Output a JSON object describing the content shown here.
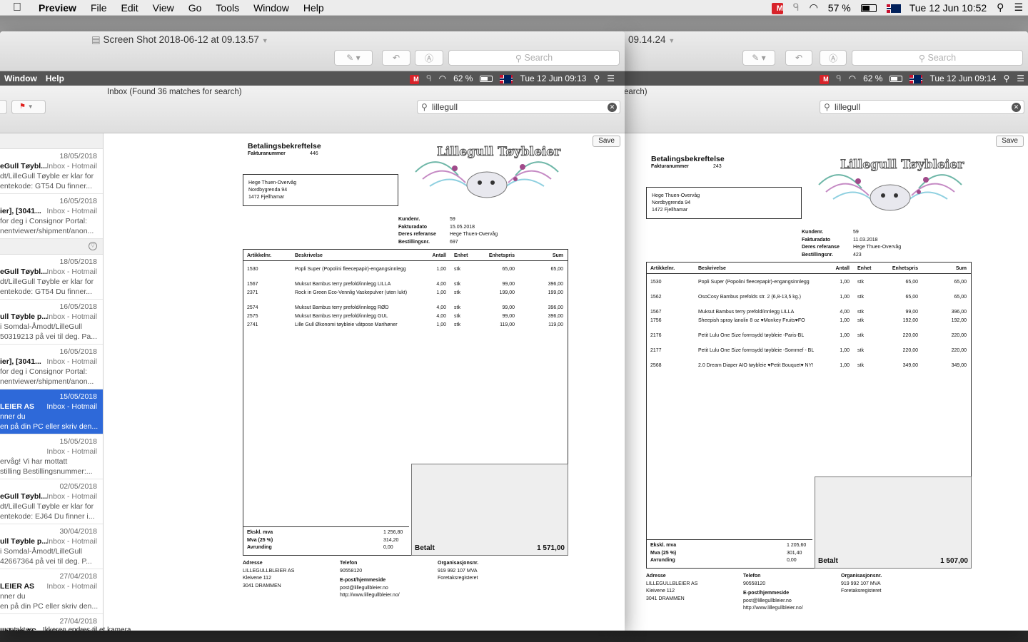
{
  "menubar": {
    "app": "Preview",
    "items": [
      "File",
      "Edit",
      "View",
      "Go",
      "Tools",
      "Window",
      "Help"
    ],
    "battery": "57 %",
    "datetime": "Tue 12 Jun  10:52"
  },
  "left_window": {
    "title": "Screen Shot 2018-06-12 at 09.13.57",
    "search_placeholder": "Search",
    "inner": {
      "menu": [
        "Window",
        "Help"
      ],
      "battery": "62 %",
      "datetime": "Tue 12 Jun  09:13",
      "mail_title": "Inbox (Found 36 matches for search)",
      "search_value": "lillegull",
      "save": "Save",
      "messages": [
        {
          "date": "18/05/2018",
          "from": "eGull Tøybl...",
          "box": "Inbox - Hotmail",
          "p1": "dt/LilleGull Tøyble er klar for",
          "p2": "entekode: GT54 Du finner..."
        },
        {
          "date": "16/05/2018",
          "from": "ier], [3041...",
          "box": "Inbox - Hotmail",
          "p1": "for deg i Consignor Portal:",
          "p2": "nentviewer/shipment/anon..."
        },
        {
          "date": "18/05/2018",
          "from": "eGull Tøybl...",
          "box": "Inbox - Hotmail",
          "p1": "dt/LilleGull Tøyble er klar for",
          "p2": "entekode: GT54 Du finner..."
        },
        {
          "date": "16/05/2018",
          "from": "ull Tøyble p...",
          "box": "Inbox - Hotmail",
          "p1": "i Somdal-Åmodt/LilleGull",
          "p2": "50319213 på vei til deg. Pa..."
        },
        {
          "date": "16/05/2018",
          "from": "ier], [3041...",
          "box": "Inbox - Hotmail",
          "p1": "for deg i Consignor Portal:",
          "p2": "nentviewer/shipment/anon..."
        },
        {
          "date": "15/05/2018",
          "from": "LEIER AS",
          "box": "Inbox - Hotmail",
          "p1": "nner du",
          "p2": "en på din PC eller skriv den...",
          "selected": true
        },
        {
          "date": "15/05/2018",
          "from": "",
          "box": "Inbox - Hotmail",
          "p1": "ervåg! Vi har mottatt",
          "p2": "stilling Bestillingsnummer:..."
        },
        {
          "date": "02/05/2018",
          "from": "eGull Tøybl...",
          "box": "Inbox - Hotmail",
          "p1": "dt/LilleGull Tøyble er klar for",
          "p2": "entekode: EJ64 Du finner i..."
        },
        {
          "date": "30/04/2018",
          "from": "ull Tøyble p...",
          "box": "Inbox - Hotmail",
          "p1": "i Somdal-Åmodt/LilleGull",
          "p2": "42667364 på vei til deg. P..."
        },
        {
          "date": "27/04/2018",
          "from": "LEIER AS",
          "box": "Inbox - Hotmail",
          "p1": "nner du",
          "p2": "en på din PC eller skriv den..."
        },
        {
          "date": "27/04/2018",
          "from": "llbleier AS",
          "box": "Inbox - Hotmail",
          "p1": "",
          "p2": ""
        }
      ],
      "invoice": {
        "title": "Betalingsbekreftelse",
        "fakturanr_label": "Fakturanummer",
        "fakturanr": "446",
        "logo_text": "Lillegull Tøybleier",
        "addr": [
          "Hege Thuen-Overvåg",
          "Nordbygrenda 94",
          "1472 Fjellhamar"
        ],
        "meta_labels": [
          "Kundenr.",
          "Fakturadato",
          "Deres referanse",
          "Bestillingsnr."
        ],
        "meta_values": [
          "59",
          "15.05.2018",
          "Hege Thuen-Overvåg",
          "697"
        ],
        "headers": [
          "Artikkelnr.",
          "Beskrivelse",
          "Antall",
          "Enhet",
          "Enhetspris",
          "Sum"
        ],
        "rows": [
          [
            "1530",
            "Popli Super (Popolini fleecepapir)-engangsinnlegg",
            "1,00",
            "stk",
            "65,00",
            "65,00"
          ],
          [
            "1567",
            "Muksut Bambus terry prefold/innlegg LILLA",
            "4,00",
            "stk",
            "99,00",
            "396,00"
          ],
          [
            "2371",
            "Rock in Green Eco-Vennlig Vaskepulver (uten lukt)",
            "1,00",
            "stk",
            "199,00",
            "199,00"
          ],
          [
            "2574",
            "Muksut Bambus terry prefold/innlegg RØD",
            "4,00",
            "stk",
            "99,00",
            "396,00"
          ],
          [
            "2575",
            "Muksut Bambus terry prefold/innlegg GUL",
            "4,00",
            "stk",
            "99,00",
            "396,00"
          ],
          [
            "2741",
            "Lille Gull Økonomi tøybleie våtpose Marihøner",
            "1,00",
            "stk",
            "119,00",
            "119,00"
          ]
        ],
        "totals_labels": [
          "Ekskl. mva",
          "Mva (25 %)",
          "Avrunding"
        ],
        "totals_values": [
          "1 256,80",
          "314,20",
          "0,00"
        ],
        "betalt_label": "Betalt",
        "betalt": "1 571,00",
        "footer": {
          "c1": [
            "Adresse",
            "LILLEGULLBLEIER AS",
            "Kleivene 112",
            "3041 DRAMMEN"
          ],
          "c2": [
            "Telefon",
            "90558120",
            "E-post/hjemmeside",
            "post@lillegullbleier.no",
            "http://www.lillegullbleier.no/"
          ],
          "c3": [
            "Organisasjonsnr.",
            "919 992 107 MVA",
            "Foretaksregisteret"
          ]
        }
      }
    }
  },
  "right_window": {
    "title": "09.14.24",
    "search_placeholder": "Search",
    "inner": {
      "battery": "62 %",
      "datetime": "Tue 12 Jun  09:14",
      "mail_title": "earch)",
      "search_value": "lillegull",
      "save": "Save",
      "invoice": {
        "title": "Betalingsbekreftelse",
        "fakturanr_label": "Fakturanummer",
        "fakturanr": "243",
        "logo_text": "Lillegull Tøybleier",
        "addr": [
          "Hege Thuen-Overvåg",
          "Nordbygrenda 94",
          "1472 Fjellhamar"
        ],
        "meta_labels": [
          "Kundenr.",
          "Fakturadato",
          "Deres referanse",
          "Bestillingsnr."
        ],
        "meta_values": [
          "59",
          "11.03.2018",
          "Hege Thuen-Overvåg",
          "423"
        ],
        "headers": [
          "Artikkelnr.",
          "Beskrivelse",
          "Antall",
          "Enhet",
          "Enhetspris",
          "Sum"
        ],
        "rows": [
          [
            "1530",
            "Popli Super (Popolini fleecepapir)-engangsinnlegg",
            "1,00",
            "stk",
            "65,00",
            "65,00"
          ],
          [
            "1562",
            "OsoCosy Bambus prefolds str. 2 (6,8-13,5 kg.)",
            "1,00",
            "stk",
            "65,00",
            "65,00"
          ],
          [
            "1567",
            "Muksut Bambus terry prefold/innlegg LILLA",
            "4,00",
            "stk",
            "99,00",
            "396,00"
          ],
          [
            "1756",
            "Sheepish spray lanolin 8 oz ♥Monkey Fruits♥FO",
            "1,00",
            "stk",
            "192,00",
            "192,00"
          ],
          [
            "2176",
            "Petit Lulu One Size formsydd tøybleie -Paris-BL",
            "1,00",
            "stk",
            "220,00",
            "220,00"
          ],
          [
            "2177",
            "Petit Lulu One Size formsydd tøybleie -Sommef - BL",
            "1,00",
            "stk",
            "220,00",
            "220,00"
          ],
          [
            "2568",
            "2.0 Dream Diaper AIO tøybleie ♥Petit Bouquet♥ NY!",
            "1,00",
            "stk",
            "349,00",
            "349,00"
          ]
        ],
        "totals_labels": [
          "Ekskl. mva",
          "Mva (25 %)",
          "Avrunding"
        ],
        "totals_values": [
          "1 205,60",
          "301,40",
          "0,00"
        ],
        "betalt_label": "Betalt",
        "betalt": "1 507,00",
        "footer": {
          "c1": [
            "Adresse",
            "LILLEGULLBLEIER AS",
            "Kleivene 112",
            "3041 DRAMMEN"
          ],
          "c2": [
            "Telefon",
            "90558120",
            "E-post/hjemmeside",
            "post@lillegullbleier.no",
            "http://www.lillegullbleier.no/"
          ],
          "c3": [
            "Organisasjonsnr.",
            "919 992 107 MVA",
            "Foretaksregisteret"
          ]
        }
      }
    }
  },
  "bottom_fragment": "...ontaktes ... Ikkeren endres til et kamera"
}
